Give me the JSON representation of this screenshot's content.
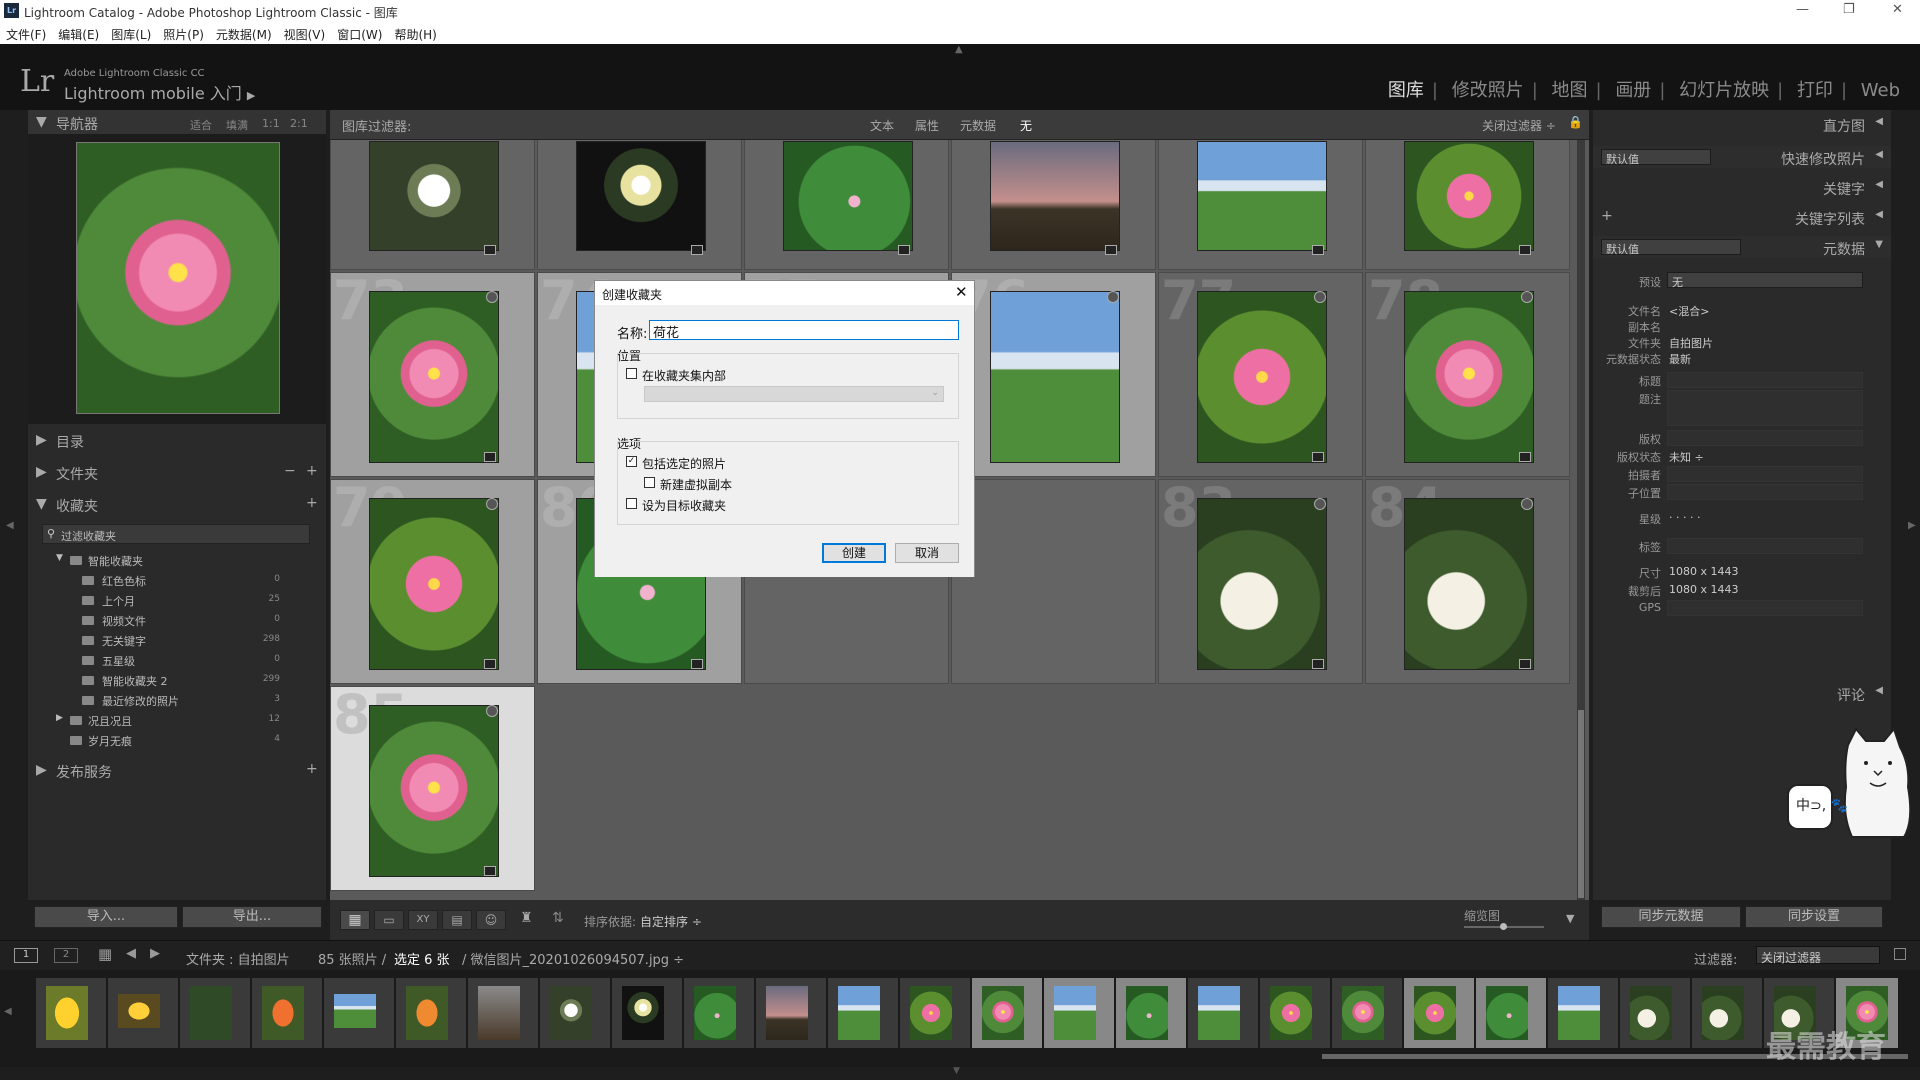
{
  "window": {
    "title": "Lightroom Catalog - Adobe Photoshop Lightroom Classic - 图库",
    "logo": "Lr"
  },
  "menu": [
    "文件(F)",
    "编辑(E)",
    "图库(L)",
    "照片(P)",
    "元数据(M)",
    "视图(V)",
    "窗口(W)",
    "帮助(H)"
  ],
  "identity": {
    "logo": "Lr",
    "product": "Adobe Lightroom Classic CC",
    "plate": "Lightroom mobile 入门",
    "arrow": "▶"
  },
  "modules": [
    "图库",
    "修改照片",
    "地图",
    "画册",
    "幻灯片放映",
    "打印",
    "Web"
  ],
  "navigator": {
    "title": "导航器",
    "zoom": [
      "适合",
      "填满",
      "1:1",
      "2:1"
    ]
  },
  "left_sections": {
    "catalog": "目录",
    "folders": "文件夹",
    "collections": "收藏夹",
    "filter_collections": "过滤收藏夹",
    "publish": "发布服务"
  },
  "collections": [
    {
      "label": "智能收藏夹",
      "count": ""
    },
    {
      "label": "红色色标",
      "count": "0"
    },
    {
      "label": "上个月",
      "count": "25"
    },
    {
      "label": "视频文件",
      "count": "0"
    },
    {
      "label": "无关键字",
      "count": "298"
    },
    {
      "label": "五星级",
      "count": "0"
    },
    {
      "label": "智能收藏夹 2",
      "count": "299"
    },
    {
      "label": "最近修改的照片",
      "count": "3"
    },
    {
      "label": "况且况且",
      "count": "12"
    },
    {
      "label": "岁月无痕",
      "count": "4"
    }
  ],
  "left_buttons": {
    "import": "导入...",
    "export": "导出..."
  },
  "filterbar": {
    "title": "图库过滤器:",
    "options": [
      "文本",
      "属性",
      "元数据",
      "无"
    ],
    "close": "关闭过滤器 ÷"
  },
  "grid": {
    "cell_numbers": [
      "73",
      "74",
      "75",
      "76",
      "77",
      "78",
      "79",
      "80",
      "83",
      "84",
      "85"
    ]
  },
  "dialog": {
    "title": "创建收藏夹",
    "name_label": "名称:",
    "name_value": "荷花",
    "location_label": "位置",
    "inside_set": "在收藏夹集内部",
    "options_label": "选项",
    "include_selected": "包括选定的照片",
    "include_checked": "✓",
    "virtual_copies": "新建虚拟副本",
    "set_target": "设为目标收藏夹",
    "create": "创建",
    "cancel": "取消"
  },
  "right_panel": {
    "histogram": "直方图",
    "quick_develop": "快速修改照片",
    "quick_preset": "默认值",
    "keywording": "关键字",
    "keyword_list": "关键字列表",
    "metadata": "元数据",
    "meta_preset": "默认值",
    "preset_label": "预设",
    "preset_value": "无",
    "comments": "评论",
    "sync_meta": "同步元数据",
    "sync_settings": "同步设置"
  },
  "metadata": [
    {
      "k": "文件名",
      "v": "<混合>"
    },
    {
      "k": "副本名",
      "v": ""
    },
    {
      "k": "文件夹",
      "v": "自拍图片"
    },
    {
      "k": "元数据状态",
      "v": "最新"
    },
    {
      "k": "标题",
      "v": ""
    },
    {
      "k": "题注",
      "v": ""
    },
    {
      "k": "版权",
      "v": ""
    },
    {
      "k": "版权状态",
      "v": "未知 ÷"
    },
    {
      "k": "拍摄者",
      "v": ""
    },
    {
      "k": "子位置",
      "v": ""
    },
    {
      "k": "星级",
      "v": "· · · · ·"
    },
    {
      "k": "标签",
      "v": ""
    },
    {
      "k": "尺寸",
      "v": "1080 x 1443"
    },
    {
      "k": "裁剪后",
      "v": "1080 x 1443"
    },
    {
      "k": "GPS",
      "v": ""
    }
  ],
  "toolbar": {
    "sort_label": "排序依据:",
    "sort_value": "自定排序 ÷",
    "thumb_label": "缩览图"
  },
  "lowbar": {
    "screen1": "1",
    "screen2": "2",
    "path": "文件夹 : 自拍图片",
    "count": "85 张照片 /",
    "selected": "选定 6 张",
    "file": "/ 微信图片_20201026094507.jpg ÷",
    "filter_label": "过滤器:",
    "filter_value": "关闭过滤器"
  },
  "watermark": "最需教育",
  "sticker": "中⊃, 🐾"
}
